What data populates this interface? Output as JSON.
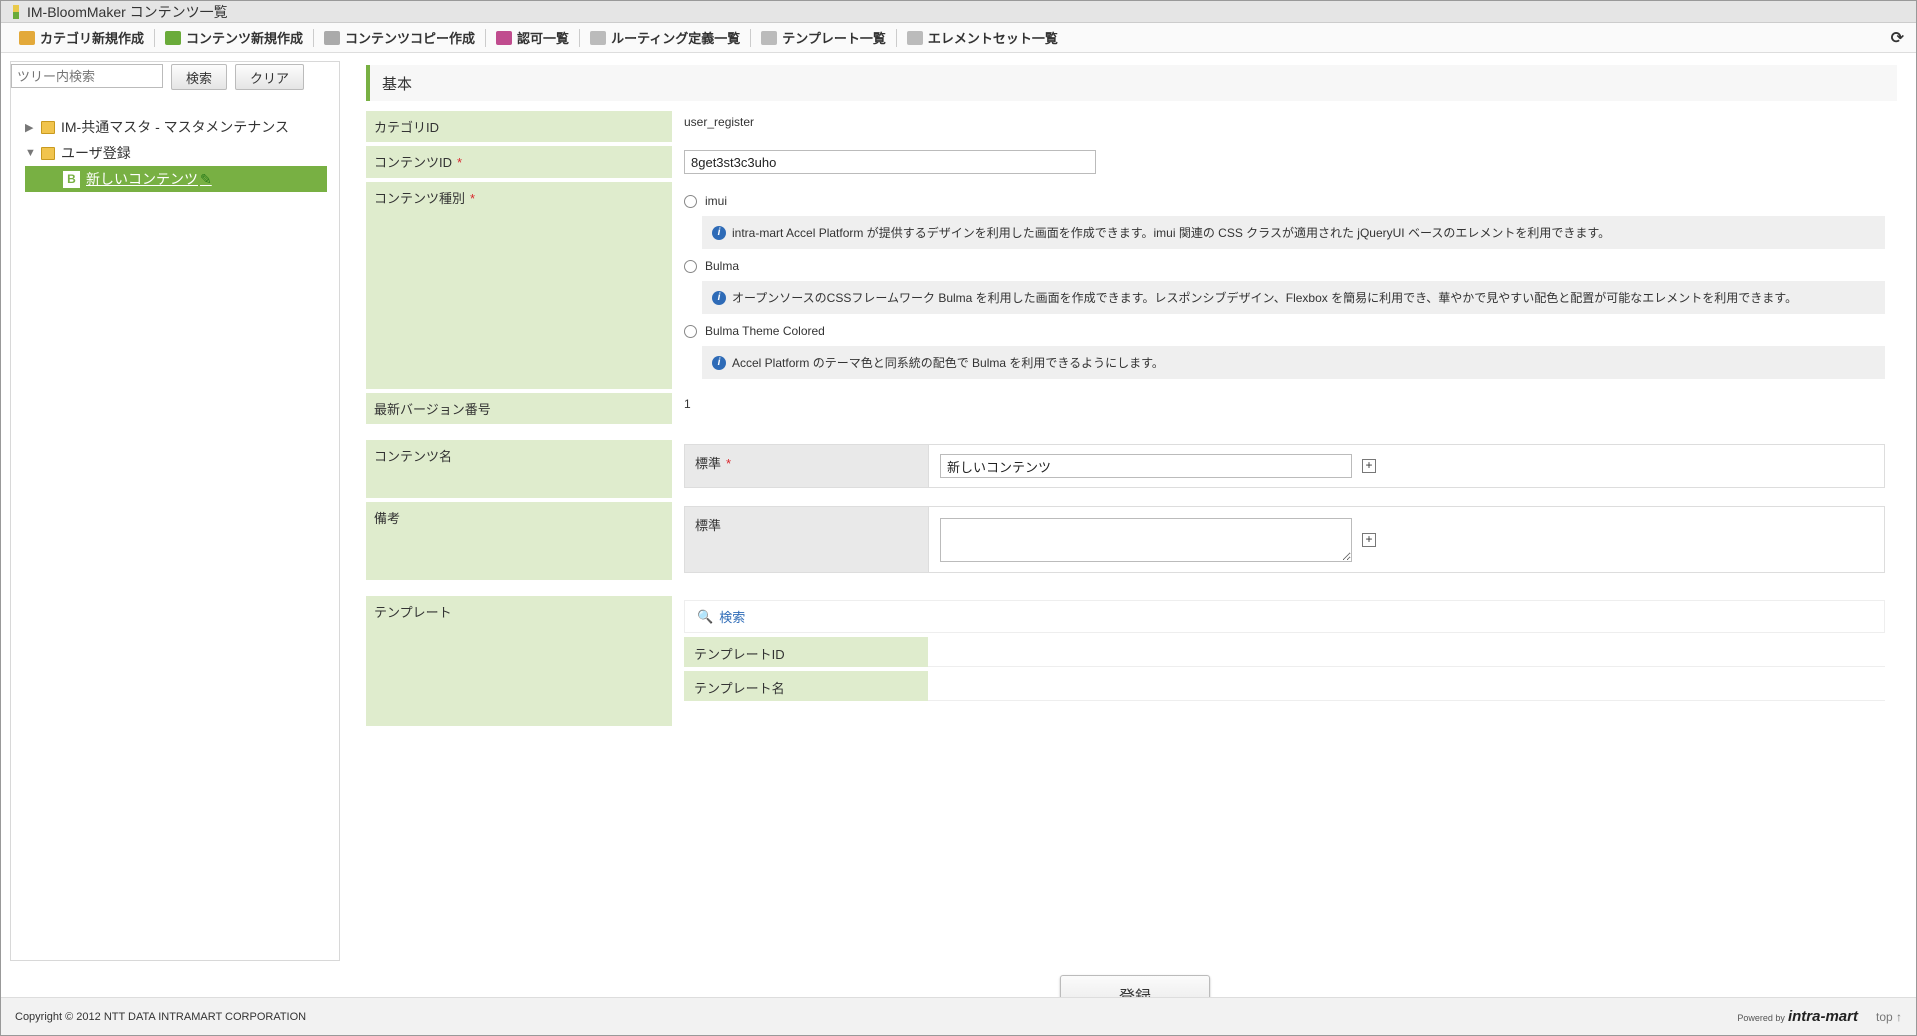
{
  "window": {
    "title": "IM-BloomMaker コンテンツ一覧"
  },
  "toolbar": {
    "items": [
      {
        "label": "カテゴリ新規作成",
        "color": "#e3a93a"
      },
      {
        "label": "コンテンツ新規作成",
        "color": "#6aab3a"
      },
      {
        "label": "コンテンツコピー作成",
        "color": "#aaaaaa"
      },
      {
        "label": "認可一覧",
        "color": "#c04c8e"
      },
      {
        "label": "ルーティング定義一覧",
        "color": "#bbbbbb"
      },
      {
        "label": "テンプレート一覧",
        "color": "#bbbbbb"
      },
      {
        "label": "エレメントセット一覧",
        "color": "#bbbbbb"
      }
    ],
    "refresh_icon": "⟳"
  },
  "sidebar": {
    "search_placeholder": "ツリー内検索",
    "search_button": "検索",
    "clear_button": "クリア",
    "tree": [
      {
        "label": "IM-共通マスタ - マスタメンテナンス",
        "expanded": false
      },
      {
        "label": "ユーザ登録",
        "expanded": true
      },
      {
        "label": "新しいコンテンツ",
        "badge": "B",
        "selected": true
      }
    ]
  },
  "content": {
    "section_title": "基本",
    "category_id_label": "カテゴリID",
    "category_id_value": "user_register",
    "content_id_label": "コンテンツID",
    "content_id_value": "8get3st3c3uho",
    "content_type_label": "コンテンツ種別",
    "content_types": [
      {
        "label": "imui",
        "info": "intra-mart Accel Platform が提供するデザインを利用した画面を作成できます。imui 関連の CSS クラスが適用された jQueryUI ベースのエレメントを利用できます。"
      },
      {
        "label": "Bulma",
        "info": "オープンソースのCSSフレームワーク Bulma を利用した画面を作成できます。レスポンシブデザイン、Flexbox を簡易に利用でき、華やかで見やすい配色と配置が可能なエレメントを利用できます。"
      },
      {
        "label": "Bulma Theme Colored",
        "info": "Accel Platform のテーマ色と同系統の配色で Bulma を利用できるようにします。"
      }
    ],
    "latest_version_label": "最新バージョン番号",
    "latest_version_value": "1",
    "content_name_label": "コンテンツ名",
    "content_name_sub_label": "標準",
    "content_name_value": "新しいコンテンツ",
    "remarks_label": "備考",
    "remarks_sub_label": "標準",
    "template_label": "テンプレート",
    "template_search": "検索",
    "template_id_label": "テンプレートID",
    "template_name_label": "テンプレート名",
    "submit_label": "登録"
  },
  "footer": {
    "copyright": "Copyright © 2012 NTT DATA INTRAMART CORPORATION",
    "powered_by": "Powered by",
    "logo_text": "intra-mart",
    "top_link": "top ↑"
  }
}
